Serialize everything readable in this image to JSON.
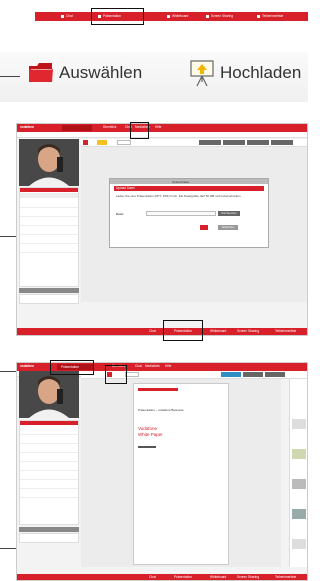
{
  "colors": {
    "brand": "#d8202a",
    "dark": "#333333",
    "panel": "#dedede"
  },
  "top_strip": {
    "items": [
      {
        "label": "Chat",
        "icon": "chat-icon"
      },
      {
        "label": "Präsentation",
        "icon": "presentation-icon"
      },
      {
        "label": "Whiteboard",
        "icon": "whiteboard-icon"
      },
      {
        "label": "Screen Sharing",
        "icon": "screen-sharing-icon"
      },
      {
        "label": "Teilnehmerliste",
        "icon": "participants-icon"
      }
    ]
  },
  "toolbar": {
    "select_label": "Auswählen",
    "upload_label": "Hochladen"
  },
  "screen1": {
    "brand": "vodafone",
    "tabs": [
      "Überblick",
      "Chat",
      "Mediathek",
      "Hilfe"
    ],
    "dialog_title": "Upload Datei",
    "dialog_heading": "Upload Datei",
    "dialog_text": "Laden Sie eine Präsentation (PPT, PDF) hoch. Die Dateigröße darf 50 MB nicht überschreiten.",
    "file_label": "Datei",
    "browse_label": "Durchsuchen",
    "upload_button": "Hochladen",
    "cancel_button": "Abbrechen",
    "footer_items": [
      "Chat",
      "Präsentation",
      "Whiteboard",
      "Screen Sharing",
      "Teilnehmerliste"
    ]
  },
  "screen2": {
    "brand": "vodafone",
    "active_tab": "Präsentation",
    "doc_lines": [
      "Präsentation – vodafone Business",
      "Vodafone",
      "White Paper"
    ],
    "footer_items": [
      "Chat",
      "Präsentation",
      "Whiteboard",
      "Screen Sharing",
      "Teilnehmerliste"
    ]
  }
}
